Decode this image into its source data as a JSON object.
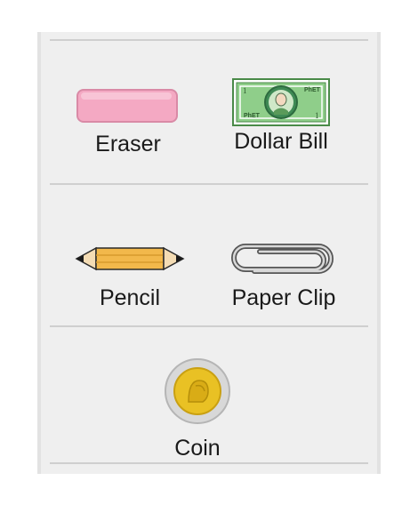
{
  "objects": {
    "eraser": {
      "label": "Eraser",
      "icon": "eraser-icon"
    },
    "dollar_bill": {
      "label": "Dollar Bill",
      "icon": "dollar-bill-icon",
      "corner_value": "1",
      "brand": "PhET"
    },
    "pencil": {
      "label": "Pencil",
      "icon": "pencil-icon"
    },
    "paper_clip": {
      "label": "Paper Clip",
      "icon": "paper-clip-icon"
    },
    "coin": {
      "label": "Coin",
      "icon": "coin-icon"
    }
  },
  "colors": {
    "panel_bg": "#efefef",
    "eraser_pink": "#f4a9c3",
    "bill_green": "#8fce8a",
    "pencil_orange": "#f2b84b",
    "coin_gold": "#e9c124"
  }
}
